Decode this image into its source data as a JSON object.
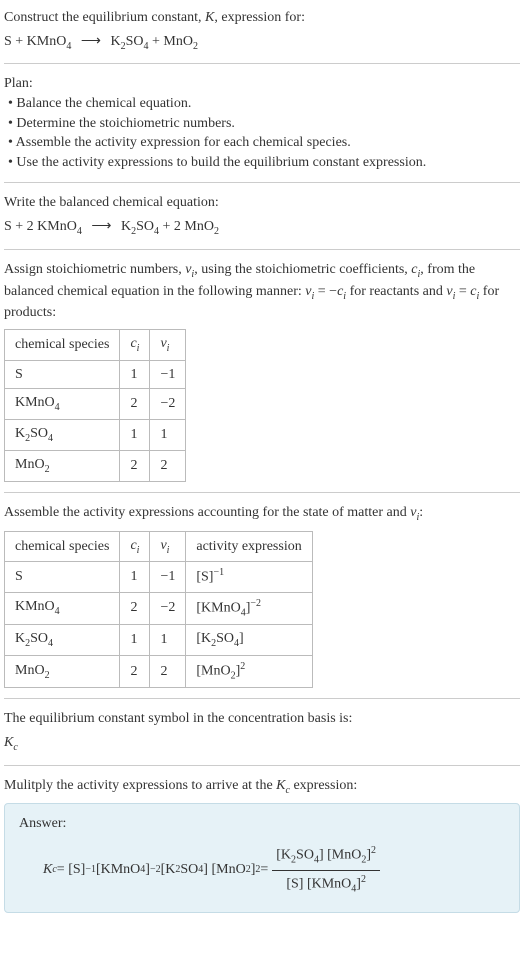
{
  "intro": {
    "line1": "Construct the equilibrium constant, ",
    "K": "K",
    "line1b": ", expression for:",
    "eq_unbalanced_left": "S + KMnO",
    "sub4a": "4",
    "eq_unbalanced_mid": "K",
    "sub2a": "2",
    "SO": "SO",
    "sub4b": "4",
    "plus": " + MnO",
    "sub2b": "2"
  },
  "plan": {
    "heading": "Plan:",
    "b1": "• Balance the chemical equation.",
    "b2": "• Determine the stoichiometric numbers.",
    "b3": "• Assemble the activity expression for each chemical species.",
    "b4": "• Use the activity expressions to build the equilibrium constant expression."
  },
  "balanced": {
    "heading": "Write the balanced chemical equation:",
    "S": "S + 2 KMnO",
    "sub4a": "4",
    "K": "K",
    "sub2a": "2",
    "SO": "SO",
    "sub4b": "4",
    "plus": " + 2 MnO",
    "sub2b": "2"
  },
  "stoich": {
    "text1": "Assign stoichiometric numbers, ",
    "nu_i": "ν",
    "sub_i1": "i",
    "text2": ", using the stoichiometric coefficients, ",
    "c_i": "c",
    "sub_i2": "i",
    "text3": ", from the balanced chemical equation in the following manner: ",
    "nu_i2": "ν",
    "sub_i3": "i",
    "eq": " = −",
    "c_i2": "c",
    "sub_i4": "i",
    "text4": " for reactants and ",
    "nu_i3": "ν",
    "sub_i5": "i",
    "eq2": " = ",
    "c_i3": "c",
    "sub_i6": "i",
    "text5": " for products:"
  },
  "table1": {
    "h1": "chemical species",
    "h2": "c",
    "h2sub": "i",
    "h3": "ν",
    "h3sub": "i",
    "rows": [
      {
        "species": "S",
        "sub": "",
        "c": "1",
        "nu": "−1"
      },
      {
        "species": "KMnO",
        "sub": "4",
        "c": "2",
        "nu": "−2"
      },
      {
        "species": "K",
        "sub": "2",
        "species2": "SO",
        "sub2": "4",
        "c": "1",
        "nu": "1"
      },
      {
        "species": "MnO",
        "sub": "2",
        "c": "2",
        "nu": "2"
      }
    ]
  },
  "assemble": {
    "text": "Assemble the activity expressions accounting for the state of matter and ",
    "nu": "ν",
    "sub_i": "i",
    "colon": ":"
  },
  "table2": {
    "h1": "chemical species",
    "h2": "c",
    "h2sub": "i",
    "h3": "ν",
    "h3sub": "i",
    "h4": "activity expression",
    "r1": {
      "sp": "S",
      "c": "1",
      "nu": "−1",
      "act_base": "[S]",
      "act_sup": "−1"
    },
    "r2": {
      "sp": "KMnO",
      "sub": "4",
      "c": "2",
      "nu": "−2",
      "act_base": "[KMnO",
      "act_sub": "4",
      "act_close": "]",
      "act_sup": "−2"
    },
    "r3": {
      "sp": "K",
      "sub": "2",
      "sp2": "SO",
      "sub2": "4",
      "c": "1",
      "nu": "1",
      "act_base": "[K",
      "act_sub1": "2",
      "act_mid": "SO",
      "act_sub2": "4",
      "act_close": "]"
    },
    "r4": {
      "sp": "MnO",
      "sub": "2",
      "c": "2",
      "nu": "2",
      "act_base": "[MnO",
      "act_sub": "2",
      "act_close": "]",
      "act_sup": "2"
    }
  },
  "kc_symbol": {
    "text": "The equilibrium constant symbol in the concentration basis is:",
    "K": "K",
    "sub_c": "c"
  },
  "multiply": {
    "text1": "Mulitply the activity expressions to arrive at the ",
    "K": "K",
    "sub_c": "c",
    "text2": " expression:"
  },
  "answer": {
    "label": "Answer:",
    "Kc": "K",
    "sub_c": "c",
    "eq": " = [S]",
    "sup1": "−1",
    "sp": " [KMnO",
    "sub4a": "4",
    "close1": "]",
    "sup2": "−2",
    "sp2": " [K",
    "sub2a": "2",
    "SO": "SO",
    "sub4b": "4",
    "close2": "] [MnO",
    "sub2b": "2",
    "close3": "]",
    "sup3": "2",
    "eq2": " = ",
    "num": {
      "p1": "[K",
      "s1": "2",
      "p2": "SO",
      "s2": "4",
      "p3": "] [MnO",
      "s3": "2",
      "p4": "]",
      "sup": "2"
    },
    "den": {
      "p1": "[S] [KMnO",
      "s1": "4",
      "p2": "]",
      "sup": "2"
    }
  },
  "arrow": "⟶"
}
